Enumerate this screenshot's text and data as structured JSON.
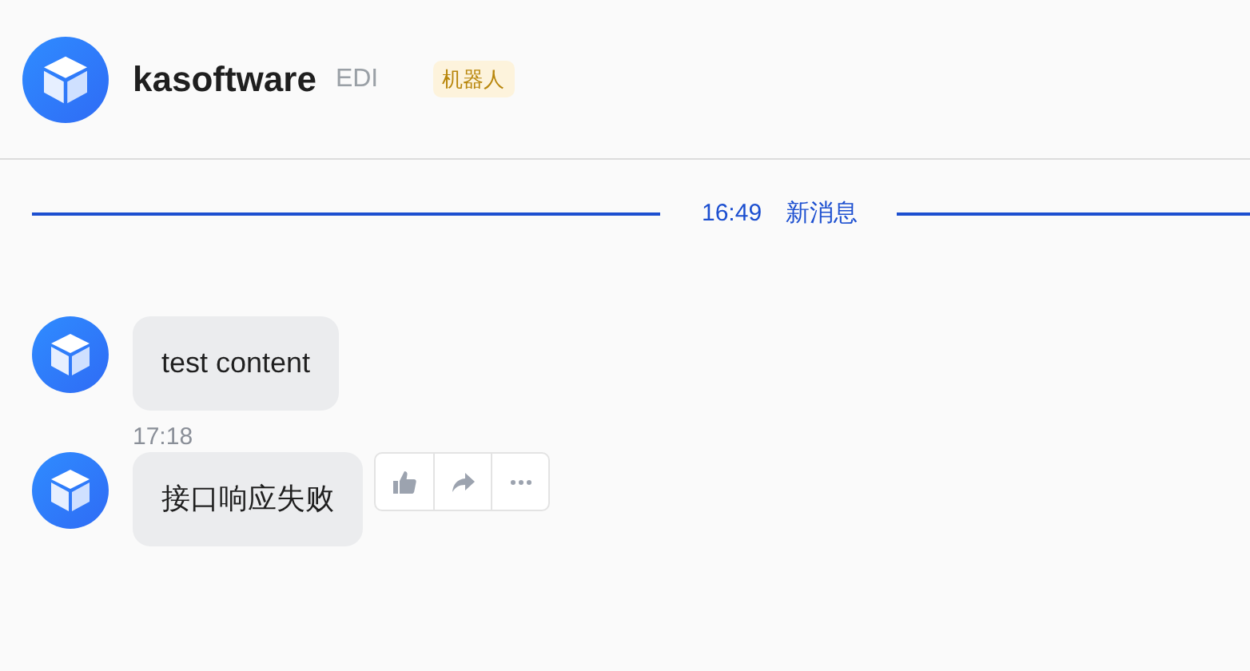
{
  "header": {
    "name": "kasoftware",
    "subtitle": "EDI",
    "badge": "机器人"
  },
  "divider": {
    "time": "16:49",
    "label": "新消息"
  },
  "messages": [
    {
      "text": "test content"
    },
    {
      "time": "17:18",
      "text": "接口响应失败",
      "actions": [
        {
          "kind": "like"
        },
        {
          "kind": "forward"
        },
        {
          "kind": "more"
        }
      ]
    }
  ]
}
